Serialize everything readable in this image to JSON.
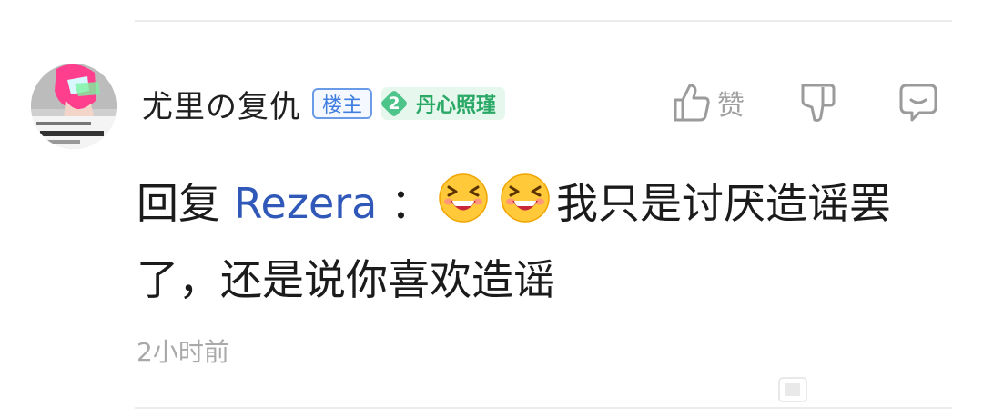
{
  "comment": {
    "username": "尤里の复仇",
    "owner_badge": "楼主",
    "level": {
      "number": "2",
      "name": "丹心照瑾"
    },
    "actions": {
      "like_label": "赞"
    },
    "content": {
      "reply_prefix": "回复",
      "reply_to": "Rezera",
      "separator": "：",
      "line": "我只是讨厌造谣罢了，还是说你喜欢造谣"
    },
    "timestamp": "2小时前"
  },
  "colors": {
    "accent_blue": "#2f58b8",
    "level_green": "#2aa866",
    "muted_gray": "#a9a9a9"
  },
  "icons": {
    "like": "thumbs-up-icon",
    "dislike": "thumbs-down-icon",
    "reply": "comment-icon",
    "emoji": "grinning-squint-emoji"
  }
}
